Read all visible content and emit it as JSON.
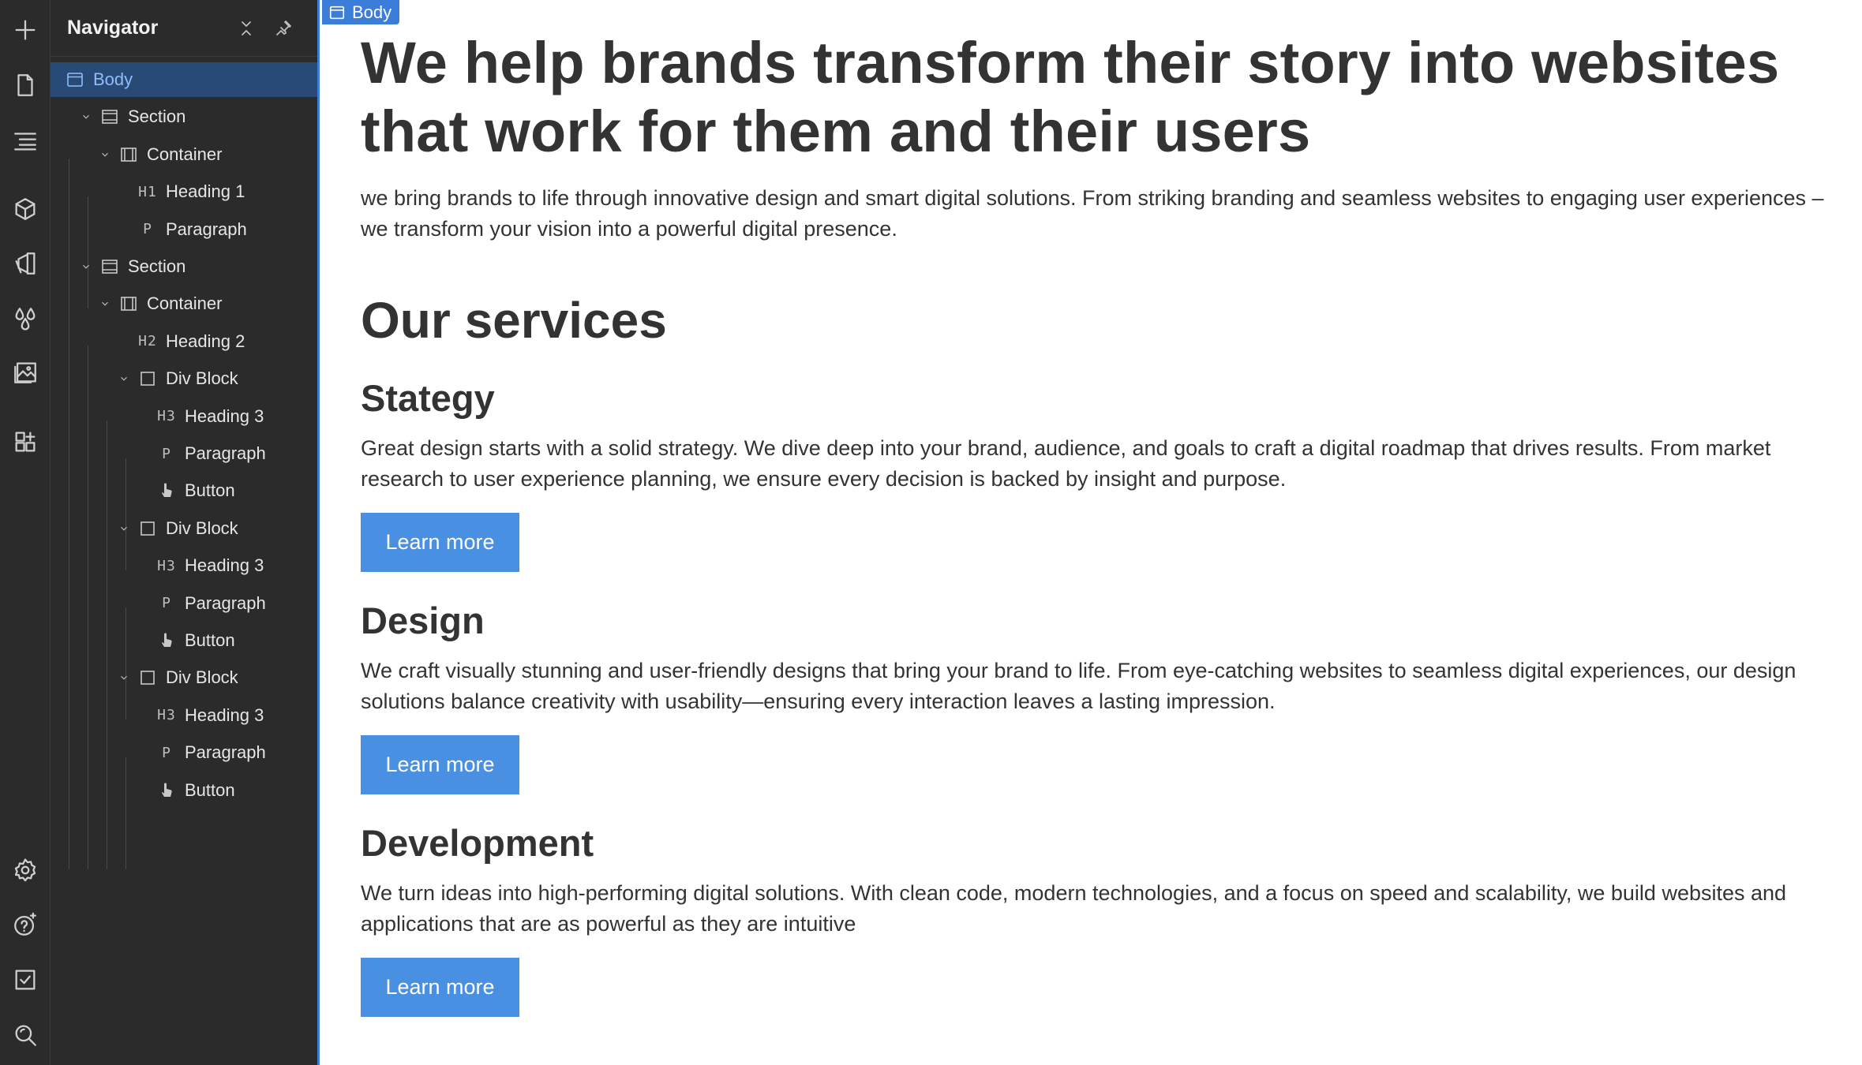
{
  "navigator": {
    "title": "Navigator",
    "tree": [
      {
        "tag": "",
        "label": "Body",
        "icon": "body-icon",
        "depth": 0,
        "expandable": false,
        "selected": true
      },
      {
        "tag": "",
        "label": "Section",
        "icon": "section-icon",
        "depth": 1,
        "expandable": true
      },
      {
        "tag": "",
        "label": "Container",
        "icon": "container-icon",
        "depth": 2,
        "expandable": true
      },
      {
        "tag": "H1",
        "label": "Heading 1",
        "icon": "heading-icon",
        "depth": 3,
        "expandable": false
      },
      {
        "tag": "P",
        "label": "Paragraph",
        "icon": "paragraph-icon",
        "depth": 3,
        "expandable": false
      },
      {
        "tag": "",
        "label": "Section",
        "icon": "section-icon",
        "depth": 1,
        "expandable": true
      },
      {
        "tag": "",
        "label": "Container",
        "icon": "container-icon",
        "depth": 2,
        "expandable": true
      },
      {
        "tag": "H2",
        "label": "Heading 2",
        "icon": "heading-icon",
        "depth": 3,
        "expandable": false
      },
      {
        "tag": "",
        "label": "Div Block",
        "icon": "div-block-icon",
        "depth": 3,
        "expandable": true
      },
      {
        "tag": "H3",
        "label": "Heading 3",
        "icon": "heading-icon",
        "depth": 4,
        "expandable": false
      },
      {
        "tag": "P",
        "label": "Paragraph",
        "icon": "paragraph-icon",
        "depth": 4,
        "expandable": false
      },
      {
        "tag": "",
        "label": "Button",
        "icon": "button-icon",
        "depth": 4,
        "expandable": false
      },
      {
        "tag": "",
        "label": "Div Block",
        "icon": "div-block-icon",
        "depth": 3,
        "expandable": true
      },
      {
        "tag": "H3",
        "label": "Heading 3",
        "icon": "heading-icon",
        "depth": 4,
        "expandable": false
      },
      {
        "tag": "P",
        "label": "Paragraph",
        "icon": "paragraph-icon",
        "depth": 4,
        "expandable": false
      },
      {
        "tag": "",
        "label": "Button",
        "icon": "button-icon",
        "depth": 4,
        "expandable": false
      },
      {
        "tag": "",
        "label": "Div Block",
        "icon": "div-block-icon",
        "depth": 3,
        "expandable": true
      },
      {
        "tag": "H3",
        "label": "Heading 3",
        "icon": "heading-icon",
        "depth": 4,
        "expandable": false
      },
      {
        "tag": "P",
        "label": "Paragraph",
        "icon": "paragraph-icon",
        "depth": 4,
        "expandable": false
      },
      {
        "tag": "",
        "label": "Button",
        "icon": "button-icon",
        "depth": 4,
        "expandable": false
      }
    ]
  },
  "canvas": {
    "badge": "Body",
    "hero": {
      "heading": "We help brands transform their story into websites that work for them and their users",
      "lead": "we bring brands to life through innovative design and smart digital solutions. From striking branding and seamless websites to engaging user experiences – we transform your vision into a powerful digital presence."
    },
    "services": {
      "heading": "Our services",
      "items": [
        {
          "title": "Stategy",
          "text": "Great design starts with a solid strategy. We dive deep into your brand, audience, and goals to craft a digital roadmap that drives results. From market research to user experience planning, we ensure every decision is backed by insight and purpose.",
          "button": "Learn more"
        },
        {
          "title": "Design",
          "text": "We craft visually stunning and user-friendly designs that bring your brand to life. From eye-catching websites to seamless digital experiences, our design solutions balance creativity with usability—ensuring every interaction leaves a lasting impression.",
          "button": "Learn more"
        },
        {
          "title": "Development",
          "text": "We turn ideas into high-performing digital solutions. With clean code, modern technologies, and a focus on speed and scalability, we build websites and applications that are as powerful as they are intuitive",
          "button": "Learn more"
        }
      ]
    }
  },
  "colors": {
    "accent": "#3b7dd8",
    "button": "#4a90e2",
    "panel": "#2b2b2b",
    "selected_row": "#284a75",
    "text": "#333333"
  }
}
